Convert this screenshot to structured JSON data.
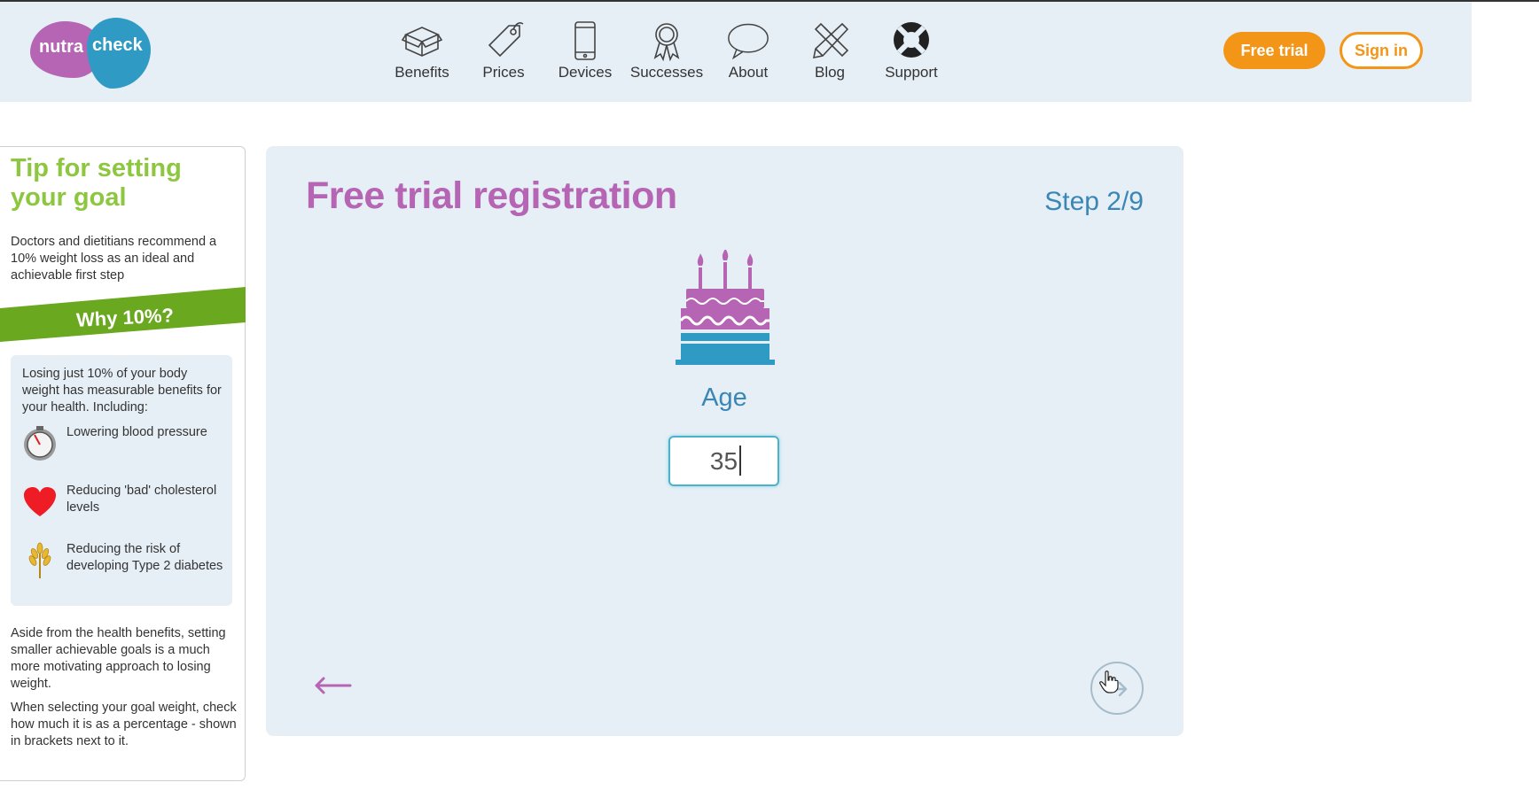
{
  "header": {
    "logo": {
      "part1": "nutra",
      "part2": "check"
    },
    "nav": [
      {
        "label": "Benefits",
        "icon": "box-icon"
      },
      {
        "label": "Prices",
        "icon": "price-tag-icon"
      },
      {
        "label": "Devices",
        "icon": "phone-icon"
      },
      {
        "label": "Successes",
        "icon": "award-ribbon-icon"
      },
      {
        "label": "About",
        "icon": "speech-bubble-icon"
      },
      {
        "label": "Blog",
        "icon": "pencil-ruler-icon"
      },
      {
        "label": "Support",
        "icon": "lifebuoy-icon"
      }
    ],
    "free_trial_label": "Free trial",
    "sign_in_label": "Sign in"
  },
  "sidebar": {
    "tip_title": "Tip for setting your goal",
    "tip_text": "Doctors and dietitians recommend a 10% weight loss as an ideal and achievable first step",
    "why_label": "Why 10%?",
    "benefits_intro": "Losing just 10% of your body weight has measurable benefits for your health. Including:",
    "benefits": [
      {
        "label": "Lowering blood pressure",
        "icon": "pressure-gauge-icon"
      },
      {
        "label": "Reducing 'bad' cholesterol levels",
        "icon": "heart-icon"
      },
      {
        "label": "Reducing the risk of developing Type 2 diabetes",
        "icon": "wheat-icon"
      }
    ],
    "aside1": "Aside from the health benefits, setting smaller achievable goals is a much more motivating approach to losing weight.",
    "aside2": "When selecting your goal weight, check how much it is as a percentage - shown in brackets next to it."
  },
  "main": {
    "title": "Free trial registration",
    "step": "Step 2/9",
    "icon": "birthday-cake-icon",
    "field_label": "Age",
    "age_value": "35"
  },
  "colors": {
    "purple": "#b565b3",
    "blue": "#3a86b5",
    "orange": "#f39517",
    "green": "#8dc63f",
    "panel_bg": "#e6eff6"
  }
}
